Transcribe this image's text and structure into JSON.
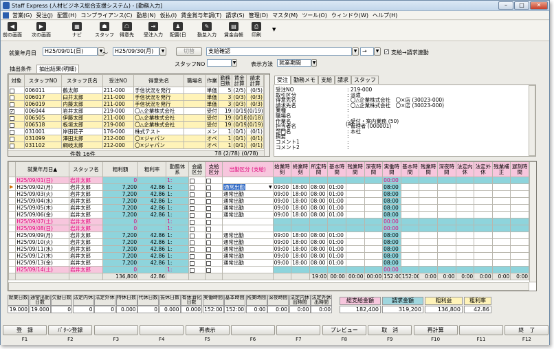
{
  "title": "Staff Express (人材ビジネス総合支援システム) - [勤務入力]",
  "menus": [
    "営業(G)",
    "受注(J)",
    "配置(H)",
    "コンプライアンス(C)",
    "勤怠(N)",
    "仮払(I)",
    "賃金賞与年調(T)",
    "請求(S)",
    "管理(D)",
    "マスタ(M)",
    "ツール(O)",
    "ウィンドウ(W)",
    "ヘルプ(H)"
  ],
  "toolbar": {
    "back": "前の画面",
    "next": "次の画面",
    "navi": "ナビ",
    "staff": "スタッフ",
    "client": "得意先",
    "order": "受注入力",
    "assign": "配置(日",
    "attend": "勤怠入力",
    "ledger": "賃金台帳",
    "print": "印刷"
  },
  "filter": {
    "date_label": "就業年月日",
    "date_from": "H25/09/01(日)",
    "tilde": "～",
    "date_to": "H25/09/30(月)",
    "switch_btn": "切替",
    "status": "支給確認",
    "arrow": "→",
    "link_check": "支給→請求連動",
    "staff_no_label": "スタッフNO",
    "display_label": "表示方法",
    "display_value": "就業期間"
  },
  "tabs": {
    "cond": "抽出条件",
    "result": "抽出結果(明細)"
  },
  "staff_list": {
    "headers": [
      "対象",
      "スタッフNO",
      "スタッフ氏名",
      "受注NO",
      "得意先名",
      "職場名",
      "作業",
      "勤務日数",
      "賃金計算",
      "請求計算"
    ],
    "rows": [
      [
        "",
        "006011",
        "鶴太郎",
        "211-000",
        "手信状況を発行",
        "",
        "単価",
        "5",
        "(2/5)",
        "(0/5)"
      ],
      [
        "",
        "006017",
        "臼井太郎",
        "211-000",
        "手信状況を発行",
        "",
        "単価",
        "3",
        "(0/3)",
        "(0/3)"
      ],
      [
        "",
        "006019",
        "内藤太郎",
        "211-000",
        "手信状況を発行",
        "",
        "単価",
        "3",
        "(0/3)",
        "(0/3)"
      ],
      [
        "✓",
        "006044",
        "岩井太郎",
        "219-000",
        "〇△企業株式会社",
        "",
        "受付",
        "19",
        "(0/19)",
        "(0/19)"
      ],
      [
        "",
        "006505",
        "伊藤太郎",
        "211-000",
        "〇△企業株式会社",
        "",
        "受付",
        "19",
        "(0/18)",
        "(0/18)"
      ],
      [
        "",
        "006518",
        "板垣太郎",
        "219-000",
        "〇△企業株式会社",
        "",
        "受付",
        "19",
        "(0/19)",
        "(0/19)"
      ],
      [
        "",
        "031001",
        "岸田花子",
        "176-000",
        "株式テスト",
        "",
        "メン",
        "1",
        "(0/1)",
        "(0/1)"
      ],
      [
        "",
        "031099",
        "澤田太郎",
        "212-000",
        "〇×ジャパン",
        "",
        "オペ",
        "1",
        "(0/1)",
        "(0/1)"
      ],
      [
        "",
        "031102",
        "綱岐太郎",
        "212-000",
        "〇×ジャパン",
        "",
        "オペ",
        "1",
        "(0/1)",
        "(0/1)"
      ]
    ],
    "count_label": "件数 16件",
    "totals": "78 (2/78) (0/78)"
  },
  "detail_tabs": [
    "受注",
    "勤務メモ",
    "支給",
    "請求",
    "スタッフ"
  ],
  "detail": {
    "labels": [
      "受注NO",
      "取引区分",
      "得意先名",
      "請求先名",
      "業種",
      "職場名",
      "作業名",
      "担当者名",
      "部門名",
      "摘要",
      "コメント1",
      "コメント2"
    ],
    "values": [
      ": 219-000",
      ": 派遣",
      ": 〇△企業株式会社　〇×店 (30023-000)",
      ": 〇△企業株式会社　〇×店 (30023-000)",
      ":",
      ":",
      ": 受付・案内業務 (50)",
      ": 管理者 (000001)",
      ": 本社",
      ":",
      ":",
      ":"
    ],
    "extra": "(4)"
  },
  "work_grid": {
    "headers": [
      "就業年月日▲",
      "スタッフ名",
      "粗利額",
      "粗利率",
      "勤務体系",
      "会議区分",
      "支給区分",
      "出勤区分 (支給)",
      "始業時刻",
      "終業時刻",
      "所定時間",
      "基本時間",
      "残業時間",
      "深夜時間",
      "実働時間",
      "基本時間",
      "残業時間",
      "深夜時間",
      "法定内休",
      "法定外休",
      "残業補正",
      "遅刻時間"
    ],
    "rows": [
      [
        "H25/09/01(日)",
        "岩井太郎",
        "0",
        "",
        "1:",
        "",
        "",
        "",
        "",
        "",
        "",
        "",
        "",
        "",
        "00:00",
        "",
        "",
        "",
        "",
        "",
        "",
        ""
      ],
      [
        "H25/09/02(月)",
        "岩井太郎",
        "7,200",
        "42.86",
        "1:",
        "",
        "",
        "通常出勤",
        "09:00",
        "18:00",
        "08:00",
        "01:00",
        "",
        "",
        "08:00",
        "",
        "",
        "",
        "",
        "",
        "",
        ""
      ],
      [
        "H25/09/03(火)",
        "岩井太郎",
        "7,200",
        "42.86",
        "1:",
        "",
        "",
        "通常出勤",
        "09:00",
        "18:00",
        "08:00",
        "01:00",
        "",
        "",
        "08:00",
        "",
        "",
        "",
        "",
        "",
        "",
        ""
      ],
      [
        "H25/09/04(水)",
        "岩井太郎",
        "7,200",
        "42.86",
        "1:",
        "",
        "",
        "通常出勤",
        "09:00",
        "18:00",
        "08:00",
        "01:00",
        "",
        "",
        "08:00",
        "",
        "",
        "",
        "",
        "",
        "",
        ""
      ],
      [
        "H25/09/05(木)",
        "岩井太郎",
        "7,200",
        "42.86",
        "1:",
        "",
        "",
        "通常出勤",
        "09:00",
        "18:00",
        "08:00",
        "01:00",
        "",
        "",
        "08:00",
        "",
        "",
        "",
        "",
        "",
        "",
        ""
      ],
      [
        "H25/09/06(金)",
        "岩井太郎",
        "7,200",
        "42.86",
        "1:",
        "",
        "",
        "通常出勤",
        "09:00",
        "18:00",
        "08:00",
        "01:00",
        "",
        "",
        "08:00",
        "",
        "",
        "",
        "",
        "",
        "",
        ""
      ],
      [
        "H25/09/07(土)",
        "岩井太郎",
        "0",
        "",
        "1:",
        "",
        "",
        "",
        "",
        "",
        "",
        "",
        "",
        "",
        "00:00",
        "",
        "",
        "",
        "",
        "",
        "",
        ""
      ],
      [
        "H25/09/08(日)",
        "岩井太郎",
        "0",
        "",
        "1:",
        "",
        "",
        "",
        "",
        "",
        "",
        "",
        "",
        "",
        "00:00",
        "",
        "",
        "",
        "",
        "",
        "",
        ""
      ],
      [
        "H25/09/09(月)",
        "岩井太郎",
        "7,200",
        "42.86",
        "1:",
        "",
        "",
        "通常出勤",
        "09:00",
        "18:00",
        "08:00",
        "01:00",
        "",
        "",
        "08:00",
        "",
        "",
        "",
        "",
        "",
        "",
        ""
      ],
      [
        "H25/09/10(火)",
        "岩井太郎",
        "7,200",
        "42.86",
        "1:",
        "",
        "",
        "通常出勤",
        "09:00",
        "18:00",
        "08:00",
        "01:00",
        "",
        "",
        "08:00",
        "",
        "",
        "",
        "",
        "",
        "",
        ""
      ],
      [
        "H25/09/11(水)",
        "岩井太郎",
        "7,200",
        "42.86",
        "1:",
        "",
        "",
        "通常出勤",
        "09:00",
        "18:00",
        "08:00",
        "01:00",
        "",
        "",
        "08:00",
        "",
        "",
        "",
        "",
        "",
        "",
        ""
      ],
      [
        "H25/09/12(木)",
        "岩井太郎",
        "7,200",
        "42.86",
        "1:",
        "",
        "",
        "通常出勤",
        "09:00",
        "18:00",
        "08:00",
        "01:00",
        "",
        "",
        "08:00",
        "",
        "",
        "",
        "",
        "",
        "",
        ""
      ],
      [
        "H25/09/13(金)",
        "岩井太郎",
        "7,200",
        "42.86",
        "1:",
        "",
        "",
        "通常出勤",
        "09:00",
        "18:00",
        "08:00",
        "01:00",
        "",
        "",
        "08:00",
        "",
        "",
        "",
        "",
        "",
        "",
        ""
      ],
      [
        "H25/09/14(土)",
        "岩井太郎",
        "0",
        "",
        "1:",
        "",
        "",
        "",
        "",
        "",
        "",
        "",
        "",
        "",
        "00:00",
        "",
        "",
        "",
        "",
        "",
        "",
        ""
      ]
    ],
    "totals": [
      "",
      "",
      "136,800",
      "42.86",
      "",
      "",
      "",
      "",
      "",
      "",
      "19:00",
      "00:00",
      "00:00",
      "00:00",
      "152:00",
      "152:00",
      "0:00",
      "0:00",
      "0:00",
      "0:00",
      "0:00",
      "0:00"
    ]
  },
  "summary": {
    "headers": [
      "就業日数",
      "通常出勤日数",
      "欠勤日数",
      "法定内休",
      "法定外休",
      "特休日数",
      "代休日数",
      "振休日数",
      "有休消化日数",
      "実働時間",
      "基本時間",
      "残業時間",
      "深夜時間",
      "法定内休出時間",
      "法定外休出時間"
    ],
    "values": [
      "19.000",
      "19.000",
      "0",
      "0",
      "0",
      "0.000",
      "0",
      "0.000",
      "0.000",
      "152:00",
      "152:00",
      "0:00",
      "0:00",
      "0:00",
      "0:00"
    ],
    "pay_total_label": "総支給金額",
    "pay_total": "182,400",
    "bill_label": "請求金額",
    "bill": "319,200",
    "gross_label": "粗利益",
    "gross": "136,800",
    "rate_label": "粗利率",
    "rate": "42.86"
  },
  "fkeys": [
    {
      "label": "登　録",
      "key": "F1"
    },
    {
      "label": "ﾊﾟﾀｰﾝ登録",
      "key": "F2"
    },
    {
      "label": "",
      "key": "F3"
    },
    {
      "label": "",
      "key": "F4"
    },
    {
      "label": "再表示",
      "key": "F5"
    },
    {
      "label": "",
      "key": "F6"
    },
    {
      "label": "",
      "key": "F7"
    },
    {
      "label": "プレビュー",
      "key": "F8"
    },
    {
      "label": "取　消",
      "key": "F9"
    },
    {
      "label": "再計算",
      "key": "F10"
    },
    {
      "label": "",
      "key": "F11"
    },
    {
      "label": "終　了",
      "key": "F12"
    }
  ],
  "colors": {
    "pink": "#f7c6dd",
    "teal": "#8ed4dc",
    "yellow": "#fff3b8",
    "sunday": "#e0007a"
  }
}
